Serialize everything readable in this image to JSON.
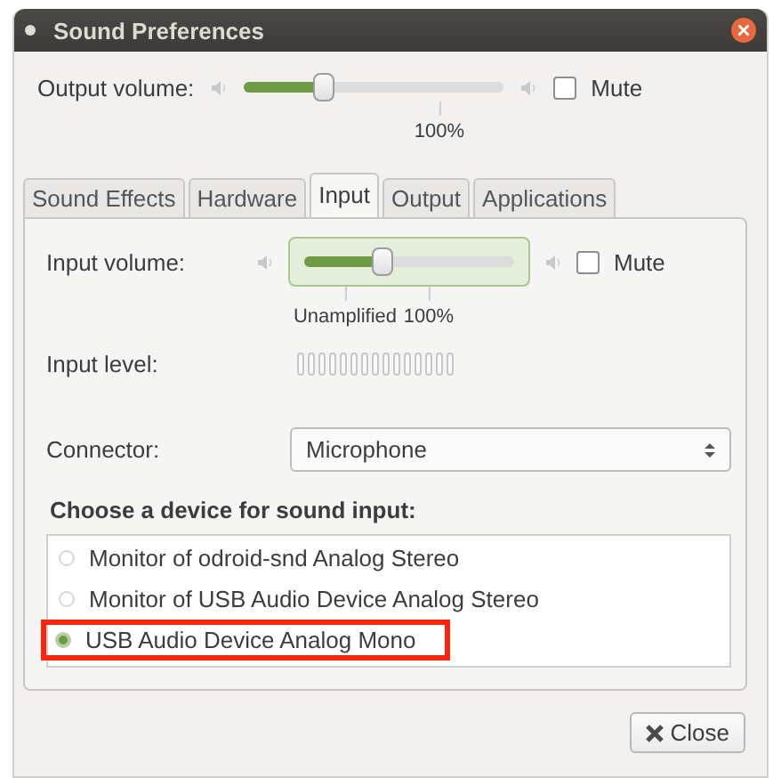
{
  "window": {
    "title": "Sound Preferences"
  },
  "output_volume": {
    "label": "Output volume:",
    "level": 0.31,
    "mute": {
      "label": "Mute",
      "checked": false
    },
    "marks": [
      "100%"
    ]
  },
  "tabs": [
    {
      "label": "Sound Effects",
      "selected": false
    },
    {
      "label": "Hardware",
      "selected": false
    },
    {
      "label": "Input",
      "selected": true
    },
    {
      "label": "Output",
      "selected": false
    },
    {
      "label": "Applications",
      "selected": false
    }
  ],
  "input_volume": {
    "label": "Input volume:",
    "level": 0.37,
    "mute": {
      "label": "Mute",
      "checked": false
    },
    "marks": [
      "Unamplified",
      "100%"
    ]
  },
  "input_level": {
    "label": "Input level:"
  },
  "connector": {
    "label": "Connector:",
    "value": "Microphone"
  },
  "devices": {
    "heading": "Choose a device for sound input:",
    "items": [
      {
        "label": "Monitor of odroid-snd Analog Stereo",
        "selected": false,
        "highlighted": false
      },
      {
        "label": "Monitor of USB Audio Device Analog Stereo",
        "selected": false,
        "highlighted": false
      },
      {
        "label": "USB Audio Device Analog Mono",
        "selected": true,
        "highlighted": true
      }
    ]
  },
  "buttons": [
    {
      "label": "Close"
    }
  ]
}
